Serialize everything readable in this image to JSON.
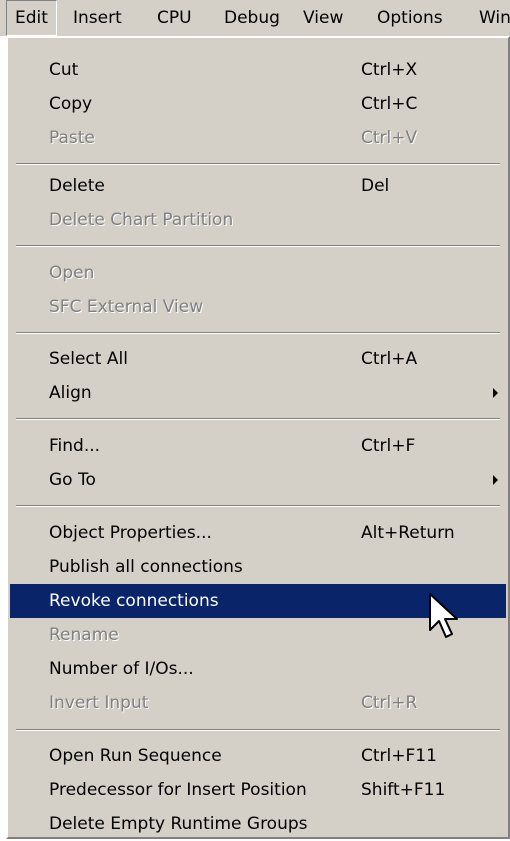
{
  "menubar": {
    "items": [
      "Edit",
      "Insert",
      "CPU",
      "Debug",
      "View",
      "Options",
      "Win"
    ]
  },
  "menu": {
    "cut": {
      "label": "Cut",
      "shortcut": "Ctrl+X"
    },
    "copy": {
      "label": "Copy",
      "shortcut": "Ctrl+C"
    },
    "paste": {
      "label": "Paste",
      "shortcut": "Ctrl+V"
    },
    "delete": {
      "label": "Delete",
      "shortcut": "Del"
    },
    "delete_chart_partition": {
      "label": "Delete Chart Partition"
    },
    "open": {
      "label": "Open"
    },
    "sfc_external_view": {
      "label": "SFC External View"
    },
    "select_all": {
      "label": "Select All",
      "shortcut": "Ctrl+A"
    },
    "align": {
      "label": "Align"
    },
    "find": {
      "label": "Find...",
      "shortcut": "Ctrl+F"
    },
    "go_to": {
      "label": "Go To"
    },
    "object_properties": {
      "label": "Object Properties...",
      "shortcut": "Alt+Return"
    },
    "publish_all_connections": {
      "label": "Publish all connections"
    },
    "revoke_connections": {
      "label": "Revoke connections"
    },
    "rename": {
      "label": "Rename"
    },
    "number_of_ios": {
      "label": "Number of I/Os..."
    },
    "invert_input": {
      "label": "Invert Input",
      "shortcut": "Ctrl+R"
    },
    "open_run_sequence": {
      "label": "Open Run Sequence",
      "shortcut": "Ctrl+F11"
    },
    "predecessor_insert": {
      "label": "Predecessor for Insert Position",
      "shortcut": "Shift+F11"
    },
    "delete_empty_runtime_groups": {
      "label": "Delete Empty Runtime Groups"
    }
  },
  "colors": {
    "menu_face": "#d4d0c8",
    "highlight": "#0a246a",
    "disabled_text": "#808080"
  }
}
